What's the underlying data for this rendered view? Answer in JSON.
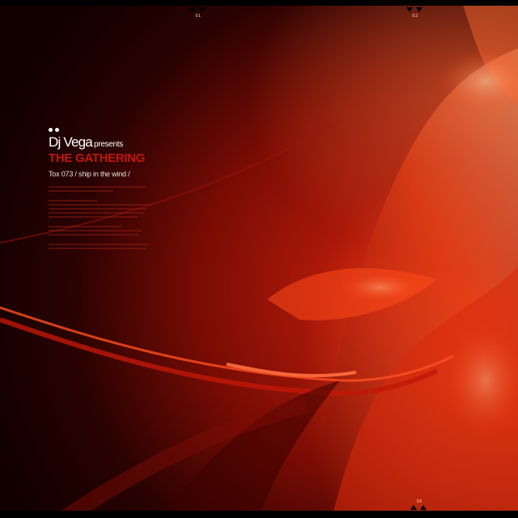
{
  "artist": "Dj Vega",
  "presents": "presents",
  "title": "THE GATHERING",
  "release": "Tox 073 / ship in the wind /",
  "markers": {
    "top_left": "01",
    "top_right": "02",
    "bottom_right": "03"
  },
  "colors": {
    "title_red": "#c0180c",
    "background_dark": "#1a0000",
    "highlight_orange": "#ff5a1e"
  }
}
